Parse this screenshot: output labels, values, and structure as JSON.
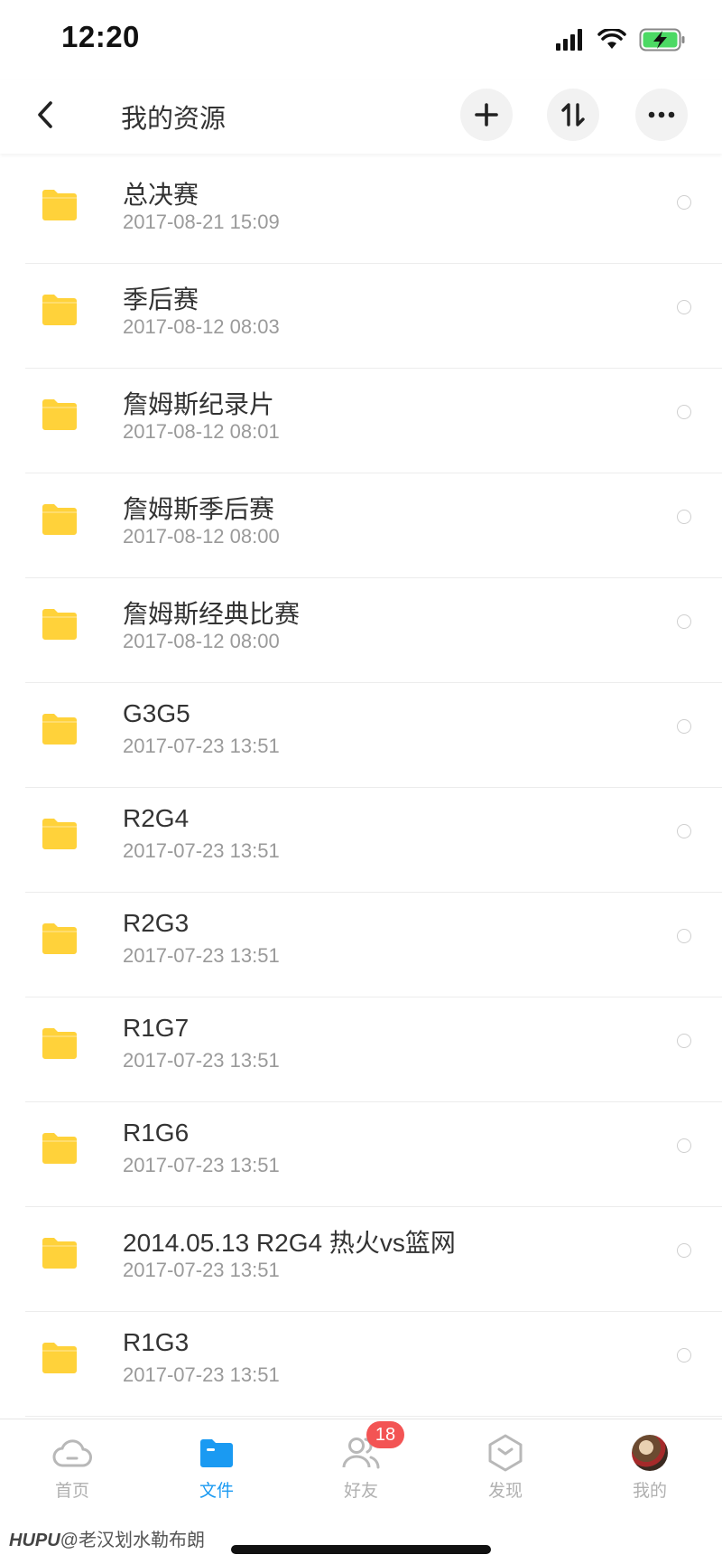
{
  "status_bar": {
    "time": "12:20",
    "signal_icon": "signal-icon",
    "wifi_icon": "wifi-icon",
    "battery_icon": "battery-charging-icon",
    "battery_color": "#4cd964"
  },
  "header": {
    "title": "我的资源",
    "back_icon": "chevron-left-icon",
    "actions": [
      "plus-icon",
      "sort-icon",
      "more-icon"
    ]
  },
  "files": [
    {
      "name": "总决赛",
      "date": "2017-08-21 15:09"
    },
    {
      "name": "季后赛",
      "date": "2017-08-12 08:03"
    },
    {
      "name": "詹姆斯纪录片",
      "date": "2017-08-12 08:01"
    },
    {
      "name": "詹姆斯季后赛",
      "date": "2017-08-12 08:00"
    },
    {
      "name": "詹姆斯经典比赛",
      "date": "2017-08-12 08:00"
    },
    {
      "name": "G3G5",
      "date": "2017-07-23 13:51"
    },
    {
      "name": "R2G4",
      "date": "2017-07-23 13:51"
    },
    {
      "name": "R2G3",
      "date": "2017-07-23 13:51"
    },
    {
      "name": "R1G7",
      "date": "2017-07-23 13:51"
    },
    {
      "name": "R1G6",
      "date": "2017-07-23 13:51"
    },
    {
      "name": "2014.05.13  R2G4 热火vs篮网",
      "date": "2017-07-23 13:51"
    },
    {
      "name": "R1G3",
      "date": "2017-07-23 13:51"
    }
  ],
  "folder_color": "#ffd23a",
  "tabs": [
    {
      "label": "首页",
      "icon": "cloud-icon",
      "active": false
    },
    {
      "label": "文件",
      "icon": "folder-icon",
      "active": true
    },
    {
      "label": "好友",
      "icon": "friends-icon",
      "active": false,
      "badge": "18"
    },
    {
      "label": "发现",
      "icon": "discover-icon",
      "active": false
    },
    {
      "label": "我的",
      "icon": "avatar",
      "active": false
    }
  ],
  "accent_color": "#1a9af2",
  "watermark": {
    "brand": "HUPU",
    "text": "@老汉划水勒布朗"
  }
}
